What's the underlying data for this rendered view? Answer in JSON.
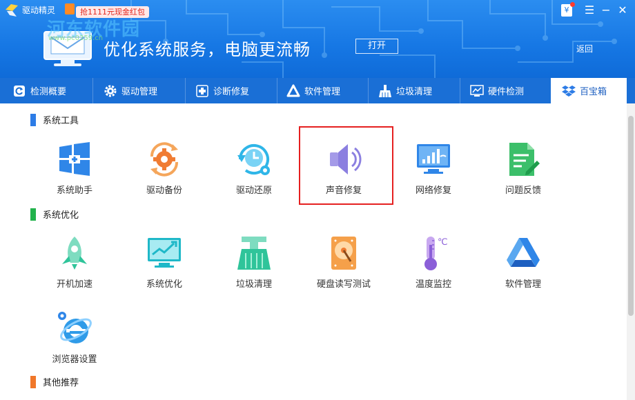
{
  "header": {
    "app_title": "驱动精灵",
    "promo_text": "抢1111元现金红包",
    "watermark": "河东软件园",
    "watermark_url": "www.pc0359.cn",
    "slogan": "优化系统服务，电脑更流畅",
    "open_button": "打开",
    "back_link": "返回",
    "wallet_symbol": "¥",
    "minimize_glyph": "☰",
    "min_glyph": "−",
    "close_glyph": "✕"
  },
  "tabs": [
    {
      "label": "检测概要",
      "icon": "refresh-icon"
    },
    {
      "label": "驱动管理",
      "icon": "gear-icon"
    },
    {
      "label": "诊断修复",
      "icon": "medical-cross-icon"
    },
    {
      "label": "软件管理",
      "icon": "triangle-app-icon"
    },
    {
      "label": "垃圾清理",
      "icon": "broom-icon"
    },
    {
      "label": "硬件检测",
      "icon": "monitor-chart-icon"
    },
    {
      "label": "百宝箱",
      "icon": "dropbox-icon",
      "active": true
    }
  ],
  "sections": [
    {
      "title": "系统工具",
      "color": "#2d7ce6",
      "tools": [
        {
          "label": "系统助手",
          "icon": "windows-plus-icon"
        },
        {
          "label": "驱动备份",
          "icon": "gear-sync-icon"
        },
        {
          "label": "驱动还原",
          "icon": "clock-restore-icon"
        },
        {
          "label": "声音修复",
          "icon": "speaker-icon"
        },
        {
          "label": "网络修复",
          "icon": "network-monitor-icon"
        },
        {
          "label": "问题反馈",
          "icon": "document-edit-icon"
        }
      ]
    },
    {
      "title": "系统优化",
      "color": "#22b24c",
      "tools": [
        {
          "label": "开机加速",
          "icon": "rocket-icon"
        },
        {
          "label": "系统优化",
          "icon": "monitor-trend-icon"
        },
        {
          "label": "垃圾清理",
          "icon": "broom-icon"
        },
        {
          "label": "硬盘读写测试",
          "icon": "hard-disk-icon"
        },
        {
          "label": "温度监控",
          "icon": "thermometer-icon"
        },
        {
          "label": "软件管理",
          "icon": "triangle-app-icon"
        },
        {
          "label": "浏览器设置",
          "icon": "ie-browser-icon"
        }
      ]
    },
    {
      "title": "其他推荐",
      "color": "#f0772a",
      "tools": []
    }
  ],
  "thermo_unit": "℃",
  "colors": {
    "header_top": "#2b8df0",
    "tab_bar": "#1a6fd6",
    "highlight_border": "#e51f1f"
  }
}
